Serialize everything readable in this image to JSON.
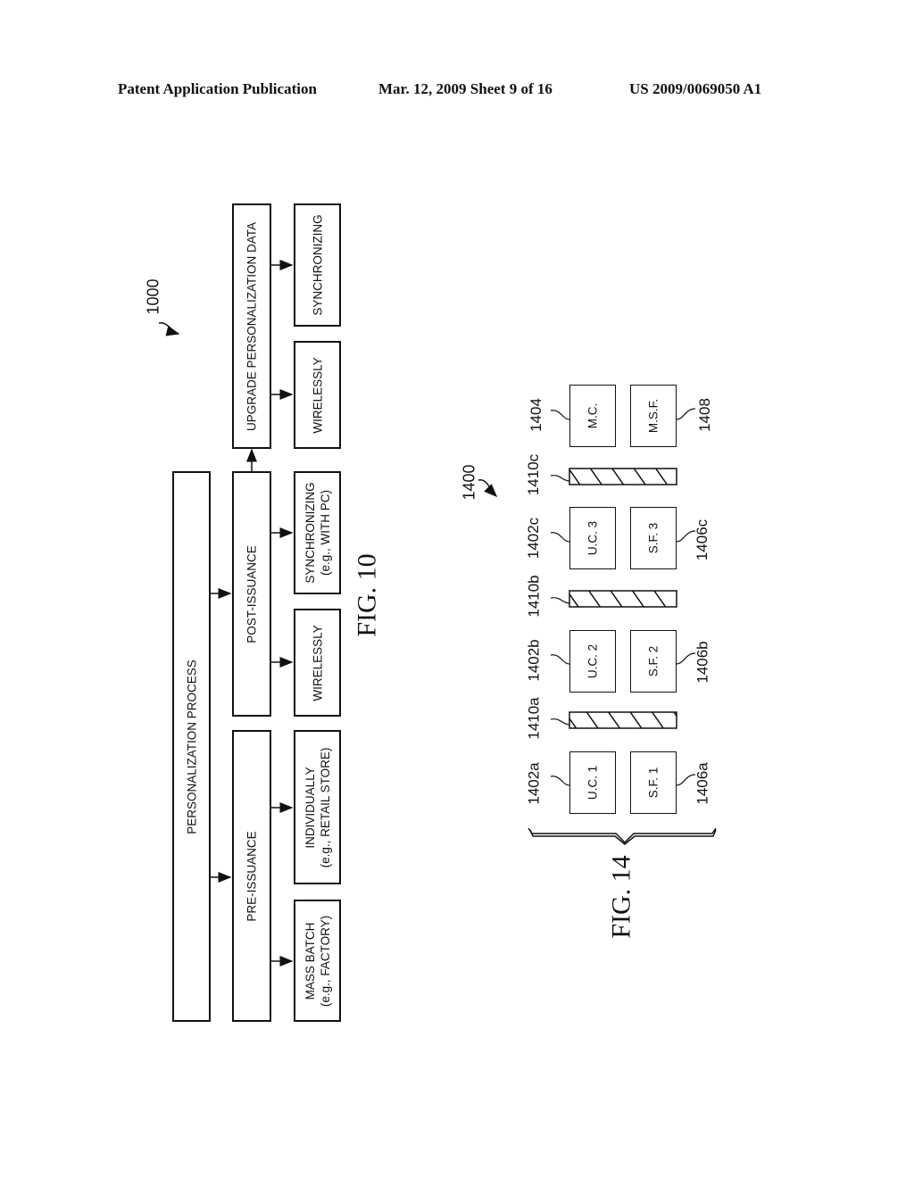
{
  "header": {
    "left": "Patent Application Publication",
    "center": "Mar. 12, 2009  Sheet 9 of 16",
    "right": "US 2009/0069050 A1"
  },
  "fig10": {
    "caption": "FIG. 10",
    "ref": "1000",
    "root": "PERSONALIZATION PROCESS",
    "pre_issuance": "PRE-ISSUANCE",
    "post_issuance": "POST-ISSUANCE",
    "upgrade": "UPGRADE PERSONALIZATION DATA",
    "leaves": {
      "mass_batch": [
        "MASS BATCH",
        "(e.g., FACTORY)"
      ],
      "individually": [
        "INDIVIDUALLY",
        "(e.g., RETAIL STORE)"
      ],
      "wirelessly_post": [
        "WIRELESSLY"
      ],
      "sync_pc": [
        "SYNCHRONIZING",
        "(e.g., WITH PC)"
      ],
      "wirelessly_upgrade": [
        "WIRELESSLY"
      ],
      "sync_upgrade": [
        "SYNCHRONIZING"
      ]
    }
  },
  "fig14": {
    "caption": "FIG. 14",
    "ref": "1400",
    "boxes": {
      "uc1": "U.C. 1",
      "sf1": "S.F. 1",
      "uc2": "U.C. 2",
      "sf2": "S.F. 2",
      "uc3": "U.C. 3",
      "sf3": "S.F. 3",
      "mc": "M.C.",
      "msf": "M.S.F."
    },
    "labels": {
      "l1402a": "1402a",
      "l1406a": "1406a",
      "l1410a": "1410a",
      "l1402b": "1402b",
      "l1406b": "1406b",
      "l1410b": "1410b",
      "l1402c": "1402c",
      "l1406c": "1406c",
      "l1410c": "1410c",
      "l1404": "1404",
      "l1408": "1408"
    }
  }
}
